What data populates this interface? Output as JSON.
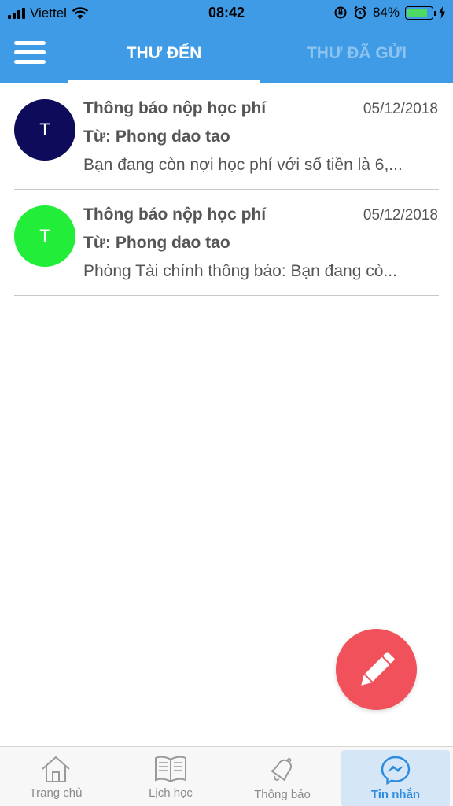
{
  "status_bar": {
    "carrier": "Viettel",
    "time": "08:42",
    "battery": "84%",
    "battery_level": 0.84
  },
  "header": {
    "menu_icon": "hamburger-menu-icon",
    "tabs": [
      {
        "label": "THƯ ĐẾN",
        "active": true
      },
      {
        "label": "THƯ ĐÃ GỬI",
        "active": false
      }
    ]
  },
  "messages": [
    {
      "avatar_letter": "T",
      "avatar_color": "#0d0b5a",
      "subject": "Thông báo nộp học phí",
      "date": "05/12/2018",
      "from": "Từ: Phong dao tao",
      "preview": "Bạn đang còn nợi học phí với số tiền là 6,..."
    },
    {
      "avatar_letter": "T",
      "avatar_color": "#22ee3a",
      "subject": "Thông báo nộp học phí",
      "date": "05/12/2018",
      "from": "Từ: Phong dao tao",
      "preview": "Phòng Tài chính thông báo: Bạn đang cò..."
    }
  ],
  "fab": {
    "icon": "pencil-icon",
    "color": "#f0515a"
  },
  "bottom_nav": [
    {
      "label": "Trang chủ",
      "icon": "home-icon"
    },
    {
      "label": "Lịch học",
      "icon": "book-icon"
    },
    {
      "label": "Thông báo",
      "icon": "bell-icon"
    },
    {
      "label": "Tin nhắn",
      "icon": "messenger-icon",
      "active": true
    }
  ],
  "colors": {
    "primary": "#3f9be6",
    "active_nav": "#2d8be0"
  }
}
